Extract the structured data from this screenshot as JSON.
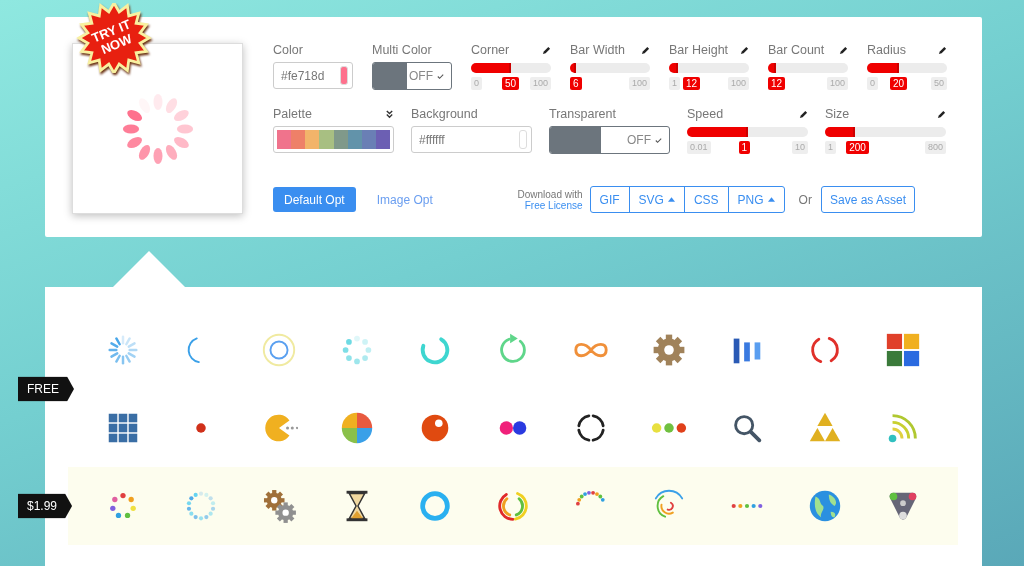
{
  "preview": {
    "badge": "TRY IT NOW"
  },
  "row1": [
    {
      "kind": "color",
      "label": "Color",
      "value": "#fe718d"
    },
    {
      "kind": "toggle",
      "label": "Multi Color",
      "on": false,
      "text": "OFF"
    },
    {
      "kind": "slider",
      "label": "Corner",
      "min": "0",
      "max": "100",
      "value": "50",
      "level": 0.5
    },
    {
      "kind": "slider",
      "label": "Bar Width",
      "max": "100",
      "value": "6",
      "level": 0.05
    },
    {
      "kind": "slider",
      "label": "Bar Height",
      "min": "1",
      "max": "100",
      "value": "12",
      "level": 0.11
    },
    {
      "kind": "slider",
      "label": "Bar Count",
      "max": "100",
      "value": "12",
      "level": 0.1
    },
    {
      "kind": "slider",
      "label": "Radius",
      "min": "0",
      "max": "50",
      "value": "20",
      "level": 0.4
    }
  ],
  "row2": [
    {
      "kind": "palette",
      "label": "Palette",
      "colors": [
        {
          "color": "#f0738c"
        },
        {
          "color": "#ee8068"
        },
        {
          "color": "#f2b46a"
        },
        {
          "color": "#a8bf82"
        },
        {
          "color": "#80998a"
        },
        {
          "color": "#6293aa"
        },
        {
          "color": "#6a7fb5"
        },
        {
          "color": "#6c5fb3"
        }
      ]
    },
    {
      "kind": "color",
      "label": "Background",
      "value": "#ffffff"
    },
    {
      "kind": "toggle",
      "label": "Transparent",
      "on": false,
      "text": "OFF"
    },
    {
      "kind": "slider",
      "label": "Speed",
      "min": "0.01",
      "max": "10",
      "value": "1",
      "level": 0.5
    },
    {
      "kind": "slider",
      "label": "Size",
      "min": "1",
      "max": "800",
      "value": "200",
      "level": 0.25
    }
  ],
  "options": [
    {
      "label": "Default Opt",
      "selected": true
    },
    {
      "label": "Image Opt",
      "selected": false
    }
  ],
  "download": {
    "caption": "Download with",
    "license": "Free License",
    "formats": [
      {
        "label": "GIF",
        "menu": false
      },
      {
        "label": "SVG",
        "menu": true
      },
      {
        "label": "CSS",
        "menu": false
      },
      {
        "label": "PNG",
        "menu": true
      }
    ],
    "or": "Or",
    "save": "Save as Asset"
  },
  "gallery": [
    {
      "tag": "FREE",
      "highlighted": false,
      "rows": [
        [
          {
            "kind": "spokes"
          },
          {
            "kind": "crescent"
          },
          {
            "kind": "double-ring"
          },
          {
            "kind": "dot-spinner"
          },
          {
            "kind": "arc-ring"
          },
          {
            "kind": "circle-arrow"
          },
          {
            "kind": "infinity"
          },
          {
            "kind": "gear"
          },
          {
            "kind": "bars"
          },
          {
            "kind": "split-ring"
          },
          {
            "kind": "squares"
          }
        ],
        [
          {
            "kind": "grid"
          },
          {
            "kind": "dot"
          },
          {
            "kind": "pacman"
          },
          {
            "kind": "pie"
          },
          {
            "kind": "ball"
          },
          {
            "kind": "two-dots"
          },
          {
            "kind": "broken-ring"
          },
          {
            "kind": "three-dots"
          },
          {
            "kind": "magnifier"
          },
          {
            "kind": "triforce"
          },
          {
            "kind": "rss"
          }
        ]
      ]
    },
    {
      "tag": "$1.99",
      "highlighted": true,
      "rows": [
        [
          {
            "kind": "color-dots"
          },
          {
            "kind": "blue-dots-ring"
          },
          {
            "kind": "gears"
          },
          {
            "kind": "hourglass"
          },
          {
            "kind": "blue-ring"
          },
          {
            "kind": "color-arcs"
          },
          {
            "kind": "dot-arc"
          },
          {
            "kind": "rainbow"
          },
          {
            "kind": "dot-line"
          },
          {
            "kind": "globe"
          },
          {
            "kind": "fidget"
          }
        ]
      ]
    }
  ]
}
